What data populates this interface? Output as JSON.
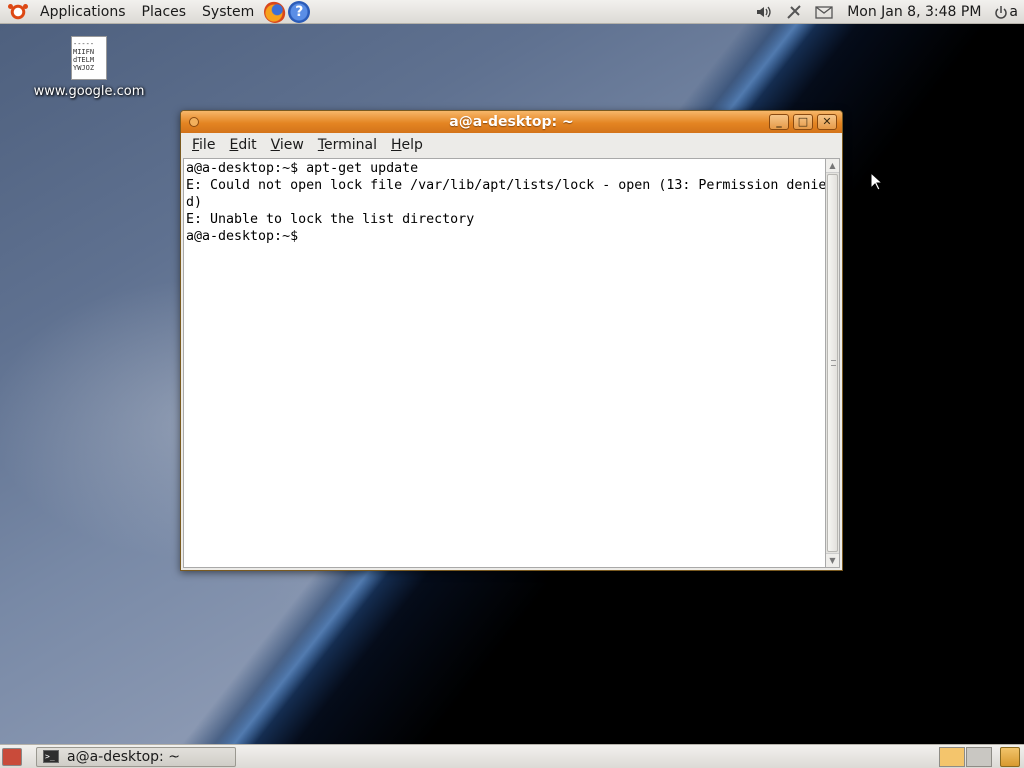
{
  "top_panel": {
    "menus": [
      "Applications",
      "Places",
      "System"
    ],
    "clock": "Mon Jan  8,  3:48 PM",
    "user": "a"
  },
  "desktop": {
    "file_icon_text": "-----\nMIIFN\ndTELM\nYWJOZ",
    "file_label": "www.google.com"
  },
  "terminal": {
    "title": "a@a-desktop: ~",
    "menu": {
      "file": {
        "mn": "F",
        "rest": "ile"
      },
      "edit": {
        "mn": "E",
        "rest": "dit"
      },
      "view": {
        "mn": "V",
        "rest": "iew"
      },
      "terminal": {
        "mn": "T",
        "rest": "erminal"
      },
      "help": {
        "mn": "H",
        "rest": "elp"
      }
    },
    "lines": [
      "a@a-desktop:~$ apt-get update",
      "E: Could not open lock file /var/lib/apt/lists/lock - open (13: Permission denie",
      "d)",
      "E: Unable to lock the list directory",
      "a@a-desktop:~$ "
    ]
  },
  "bottom_panel": {
    "task_label": "a@a-desktop: ~"
  },
  "colors": {
    "titlebar": "#e48522",
    "panel": "#dcdad5",
    "accent": "#dd4814"
  },
  "icons": [
    "ubuntu-logo-icon",
    "firefox-icon",
    "help-icon",
    "volume-icon",
    "network-icon",
    "mail-icon",
    "power-icon",
    "terminal-icon",
    "trash-icon"
  ]
}
